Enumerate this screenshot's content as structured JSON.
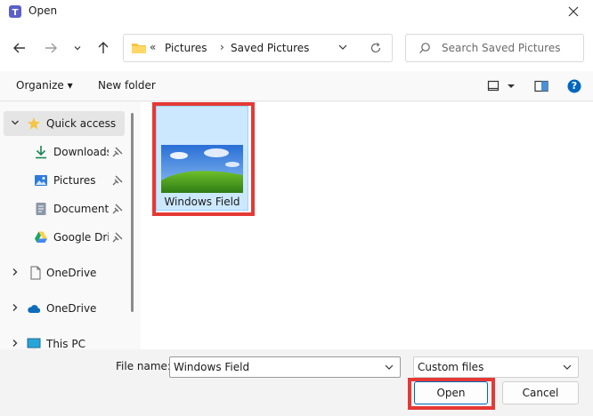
{
  "window": {
    "title": "Open"
  },
  "address": {
    "overflow": "«",
    "crumbs": [
      "Pictures",
      "Saved Pictures"
    ],
    "separator": "›"
  },
  "search": {
    "placeholder": "Search Saved Pictures"
  },
  "toolbar": {
    "organize": "Organize ▾",
    "new_folder": "New folder",
    "help": "?"
  },
  "sidebar": {
    "items": [
      {
        "label": "Quick access"
      },
      {
        "label": "Downloads"
      },
      {
        "label": "Pictures"
      },
      {
        "label": "Documents"
      },
      {
        "label": "Google Drive"
      },
      {
        "label": "OneDrive"
      },
      {
        "label": "OneDrive"
      },
      {
        "label": "This PC"
      }
    ]
  },
  "files": [
    {
      "name": "Windows Field"
    }
  ],
  "bottom": {
    "file_name_label": "File name:",
    "file_name_value": "Windows Field",
    "file_type": "Custom files",
    "open": "Open",
    "cancel": "Cancel"
  },
  "colors": {
    "accent": "#0067c0",
    "selection": "#cce8ff",
    "highlight": "#e53935"
  },
  "icons": [
    "app-icon",
    "close-icon",
    "back-arrow-icon",
    "forward-arrow-icon",
    "recent-dropdown-icon",
    "up-arrow-icon",
    "folder-icon",
    "chevron-down-icon",
    "refresh-icon",
    "search-icon",
    "view-icon",
    "preview-pane-icon",
    "help-icon",
    "star-icon",
    "download-icon",
    "pictures-icon",
    "documents-icon",
    "google-drive-icon",
    "onedrive-icon",
    "onedrive-cloud-icon",
    "this-pc-icon",
    "pin-icon"
  ]
}
